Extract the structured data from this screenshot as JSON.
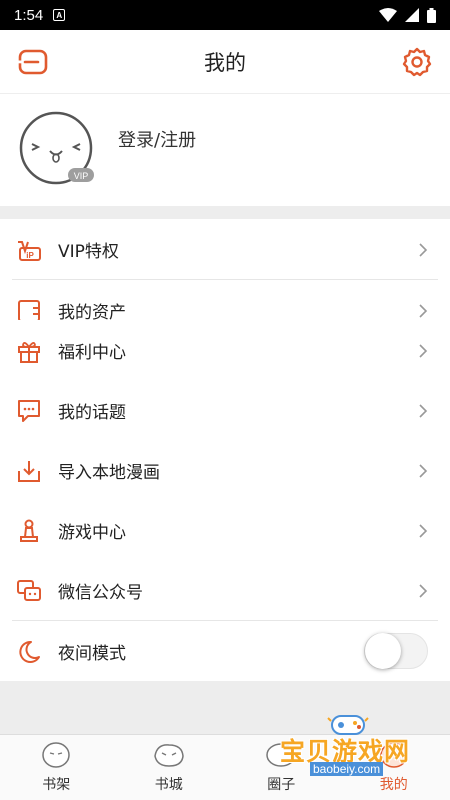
{
  "status_bar": {
    "time": "1:54",
    "notification_letter": "A"
  },
  "header": {
    "title": "我的"
  },
  "profile": {
    "login_label": "登录/注册",
    "vip_badge": "VIP"
  },
  "menu": {
    "vip": "VIP特权",
    "assets": "我的资产",
    "welfare": "福利中心",
    "topics": "我的话题",
    "import": "导入本地漫画",
    "games": "游戏中心",
    "wechat": "微信公众号",
    "night_mode": "夜间模式"
  },
  "night_mode_enabled": false,
  "bottom_nav": {
    "bookshelf": "书架",
    "bookstore": "书城",
    "circle": "圈子",
    "mine": "我的"
  },
  "watermark": {
    "text": "宝贝游戏网",
    "url": "baobeiy.com"
  },
  "colors": {
    "accent": "#e05a2f",
    "background": "#ededed"
  }
}
